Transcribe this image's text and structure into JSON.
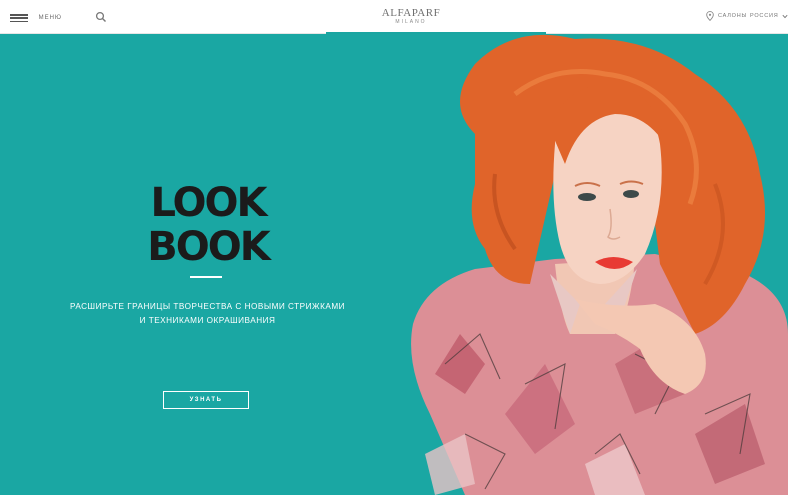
{
  "header": {
    "menu_label": "МЕНЮ",
    "logo_main": "ALFAPARF",
    "logo_sub": "MILANO",
    "salons_label": "САЛОНЫ",
    "language_label": "РОССИЯ"
  },
  "hero": {
    "logo_line1": "LOOK",
    "logo_line2": "BOOK",
    "tagline_line1": "РАСШИРЬТЕ ГРАНИЦЫ ТВОРЧЕСТВА С НОВЫМИ СТРИЖКАМИ",
    "tagline_line2": "И ТЕХНИКАМИ ОКРАШИВАНИЯ",
    "cta_label": "УЗНАТЬ"
  },
  "colors": {
    "hero_background": "#1aa7a3",
    "accent": "#1aa5a1",
    "hair": "#e0642a",
    "logo_text": "#1b1b1b"
  },
  "icons": [
    "hamburger-icon",
    "search-icon",
    "location-pin-icon",
    "chevron-down-icon"
  ]
}
